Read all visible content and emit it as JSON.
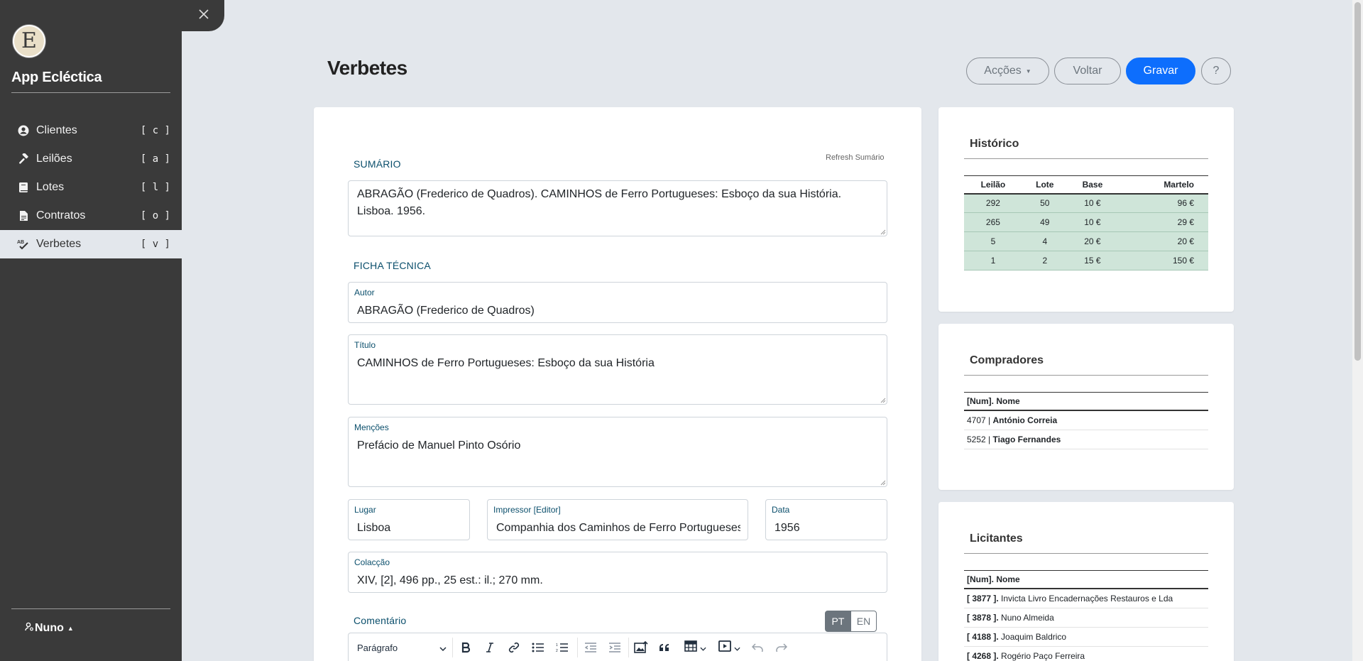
{
  "sidebar": {
    "logo_letter": "E",
    "app_name": "App Ecléctica",
    "items": [
      {
        "label": "Clientes",
        "shortcut": "[ c ]",
        "icon": "user-circle-icon"
      },
      {
        "label": "Leilões",
        "shortcut": "[ a ]",
        "icon": "gavel-icon"
      },
      {
        "label": "Lotes",
        "shortcut": "[ l ]",
        "icon": "book-icon"
      },
      {
        "label": "Contratos",
        "shortcut": "[ o ]",
        "icon": "contract-icon"
      },
      {
        "label": "Verbetes",
        "shortcut": "[ v ]",
        "icon": "spell-check-icon",
        "active": true
      }
    ],
    "user": "Nuno"
  },
  "header": {
    "title": "Verbetes",
    "actions_label": "Acções",
    "back_label": "Voltar",
    "save_label": "Gravar",
    "help_label": "?"
  },
  "form": {
    "summary_label": "SUMÁRIO",
    "refresh_label": "Refresh Sumário",
    "summary_value": "ABRAGÃO (Frederico de Quadros). CAMINHOS de Ferro Portugueses: Esboço da sua História. Lisboa. 1956.",
    "tech_label": "FICHA TÉCNICA",
    "autor": {
      "label": "Autor",
      "value": "ABRAGÃO (Frederico de Quadros)"
    },
    "titulo": {
      "label": "Título",
      "value": "CAMINHOS de Ferro Portugueses: Esboço da sua História"
    },
    "mencoes": {
      "label": "Menções",
      "value": "Prefácio de Manuel Pinto Osório"
    },
    "lugar": {
      "label": "Lugar",
      "value": "Lisboa"
    },
    "impressor": {
      "label": "Impressor [Editor]",
      "value": "Companhia dos Caminhos de Ferro Portugueses"
    },
    "data": {
      "label": "Data",
      "value": "1956"
    },
    "colaccao": {
      "label": "Colacção",
      "value": "XIV, [2], 496 pp., 25 est.: il.; 270 mm."
    },
    "comment_label": "Comentário",
    "lang_pt": "PT",
    "lang_en": "EN",
    "editor_block_format": "Parágrafo"
  },
  "historico": {
    "title": "Histórico",
    "columns": [
      "Leilão",
      "Lote",
      "Base",
      "Martelo"
    ],
    "rows": [
      [
        "292",
        "50",
        "10 €",
        "96 €"
      ],
      [
        "265",
        "49",
        "10 €",
        "29 €"
      ],
      [
        "5",
        "4",
        "20 €",
        "20 €"
      ],
      [
        "1",
        "2",
        "15 €",
        "150 €"
      ]
    ],
    "row_color": "#cfe5d9"
  },
  "compradores": {
    "title": "Compradores",
    "header": "[Num]. Nome",
    "rows": [
      {
        "num": "4707 |",
        "name": "António Correia"
      },
      {
        "num": "5252 |",
        "name": "Tiago Fernandes"
      }
    ]
  },
  "licitantes": {
    "title": "Licitantes",
    "header": "[Num]. Nome",
    "rows": [
      {
        "num": "[ 3877 ].",
        "name": "Invicta Livro Encadernações Restauros e Lda"
      },
      {
        "num": "[ 3878 ].",
        "name": "Nuno Almeida"
      },
      {
        "num": "[ 4188 ].",
        "name": "Joaquim Baldrico"
      },
      {
        "num": "[ 4268 ].",
        "name": "Rogério Paço Ferreira"
      }
    ]
  },
  "colors": {
    "sidebar_bg": "#3a3a3a",
    "page_bg": "#e3e7ec",
    "primary": "#0d6efd",
    "label_teal": "#0b4f6c"
  }
}
